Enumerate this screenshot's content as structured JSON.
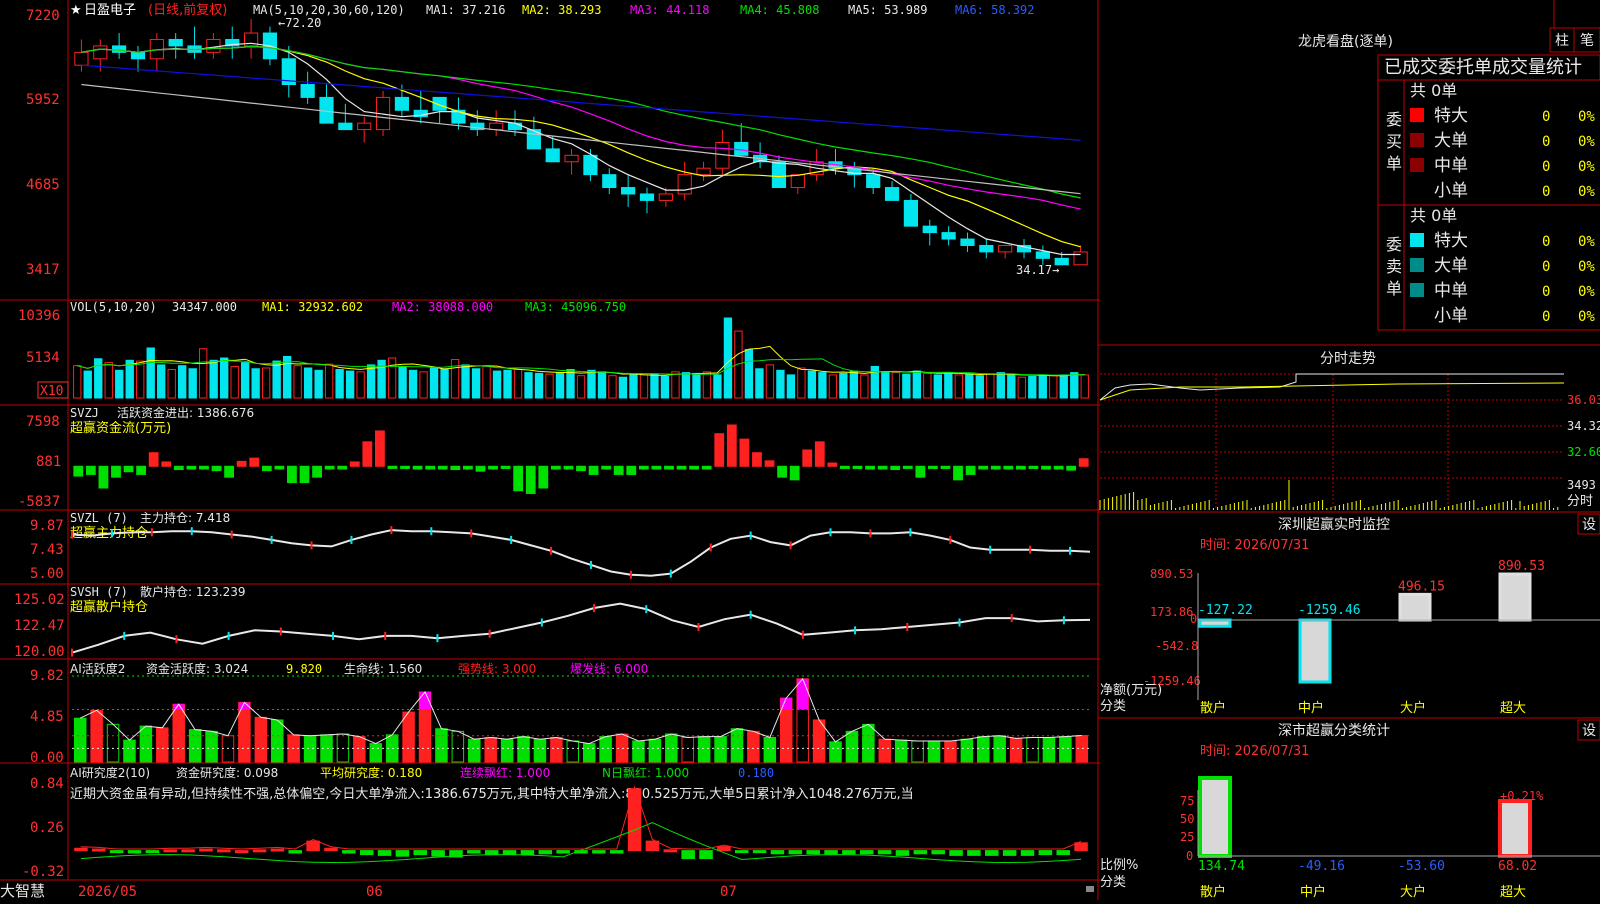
{
  "stock": {
    "star": "★",
    "name": "日盈电子",
    "mode": "(日线,前复权)"
  },
  "colors": {
    "up": "#ff2020",
    "down": "#00e5ee",
    "green": "#00e000",
    "white": "#e8e8e8",
    "yellow": "#ffff00",
    "magenta": "#ff00ff",
    "blue": "#1010dd",
    "grid": "#c00000"
  },
  "main_header": {
    "ma_label": "MA(5,10,20,30,60,120)",
    "ma1": "MA1: 37.216",
    "ma2": "MA2: 38.293",
    "ma3": "MA3: 44.118",
    "ma4": "MA4: 45.808",
    "ma5": "MA5: 53.989",
    "ma6": "MA6: 58.392",
    "high_note": "←72.20",
    "low_note": "34.17→"
  },
  "price_axis": [
    "7220",
    "5952",
    "4685",
    "3417"
  ],
  "vol_header": {
    "label": "VOL(5,10,20)",
    "value": "34347.000",
    "ma1": "MA1: 32932.602",
    "ma2": "MA2: 38088.000",
    "ma3": "MA3: 45096.750"
  },
  "vol_axis": [
    "10396",
    "5134"
  ],
  "vol_unit": "X10",
  "svzj": {
    "label": "SVZJ",
    "text": "活跃资金进出: 1386.676",
    "sub": "超赢资金流(万元)",
    "axis": [
      "7598",
      "881",
      "-5837"
    ]
  },
  "svzl": {
    "label": "SVZL (7)",
    "text": "主力持仓: 7.418",
    "sub": "超赢主力持仓",
    "axis": [
      "9.87",
      "7.43",
      "5.00"
    ]
  },
  "svsh": {
    "label": "SVSH (7)",
    "text": "散户持仓: 123.239",
    "sub": "超赢散户持仓",
    "axis": [
      "125.02",
      "122.47",
      "120.00"
    ]
  },
  "ai1": {
    "label": "AI活跃度2",
    "t1": "资金活跃度: 3.024",
    "t2": "9.820",
    "t3": "生命线: 1.560",
    "t4": "强势线: 3.000",
    "t5": "爆发线: 6.000",
    "axis": [
      "9.82",
      "4.85",
      "0.00"
    ]
  },
  "ai2": {
    "label": "AI研究度2(10)",
    "t1": "资金研究度: 0.098",
    "t2": "平均研究度: 0.180",
    "t3": "连续飘红: 1.000",
    "t4": "N日飘红: 1.000",
    "t5": "0.180",
    "comment": "近期大资金虽有异动,但持续性不强,总体偏空,今日大单净流入:1386.675万元,其中特大单净流入:890.525万元,大单5日累计净入1048.276万元,当",
    "axis": [
      "0.84",
      "0.26",
      "-0.32"
    ]
  },
  "dates": [
    "2026/05",
    "06",
    "07"
  ],
  "brand": "大智慧",
  "right": {
    "lhkp_title": "龙虎看盘(逐单)",
    "btn_zhu": "柱",
    "btn_bi": "笔",
    "wt_title": "已成交委托单成交量统计",
    "buy_label": "委买单",
    "sell_label": "委卖单",
    "buy_total": "共 0单",
    "sell_total": "共 0单",
    "buy_rows": [
      {
        "name": "特大",
        "v": "0",
        "p": "0%"
      },
      {
        "name": "大单",
        "v": "0",
        "p": "0%"
      },
      {
        "name": "中单",
        "v": "0",
        "p": "0%"
      },
      {
        "name": "小单",
        "v": "0",
        "p": "0%"
      }
    ],
    "sell_rows": [
      {
        "name": "特大",
        "v": "0",
        "p": "0%"
      },
      {
        "name": "大单",
        "v": "0",
        "p": "0%"
      },
      {
        "name": "中单",
        "v": "0",
        "p": "0%"
      },
      {
        "name": "小单",
        "v": "0",
        "p": "0%"
      }
    ],
    "fs_title": "分时走势",
    "fs_axis": [
      "36.03",
      "34.32",
      "32.60",
      "3493"
    ],
    "fs_unit": "分时",
    "sz_title": "深圳超赢实时监控",
    "sz_set": "设",
    "sz_time": "时间: 2026/07/31",
    "sz_axis": [
      "890.53",
      "173.86",
      "0",
      "-542.8",
      "-1259.46"
    ],
    "sz_ylabel": "净额(万元)",
    "sz_xlabel": "分类",
    "sz_cats": [
      "散户",
      "中户",
      "大户",
      "超大"
    ],
    "sz_labels": [
      "-127.22",
      "-1259.46",
      "496.15",
      "890.53"
    ],
    "ss_title": "深市超赢分类统计",
    "ss_set": "设",
    "ss_time": "时间: 2026/07/31",
    "ss_axis": [
      "75",
      "50",
      "25",
      "0"
    ],
    "ss_ylabel": "比例%",
    "ss_xlabel": "分类",
    "ss_cats": [
      "散户",
      "中户",
      "大户",
      "超大"
    ],
    "ss_labels": [
      "134.74",
      "-49.16",
      "-53.60",
      "68.02"
    ],
    "ss_note": "+0.21%"
  },
  "chart_data": [
    {
      "type": "candlestick",
      "title": "日盈电子 (日线,前复权)",
      "ylim": [
        34.17,
        72.2
      ],
      "candles": [
        [
          65,
          69,
          64,
          67
        ],
        [
          66,
          69,
          64,
          68
        ],
        [
          68,
          70,
          66,
          67
        ],
        [
          67,
          68,
          64,
          66
        ],
        [
          66,
          70,
          64,
          69
        ],
        [
          69,
          70,
          66,
          68
        ],
        [
          68,
          71,
          66,
          67
        ],
        [
          67,
          70,
          66,
          69
        ],
        [
          69,
          71,
          66,
          68
        ],
        [
          68,
          72.2,
          66,
          70
        ],
        [
          70,
          71,
          65,
          66
        ],
        [
          66,
          68,
          60,
          62
        ],
        [
          62,
          64,
          59,
          60
        ],
        [
          60,
          62,
          57,
          56
        ],
        [
          56,
          59,
          55,
          55
        ],
        [
          55,
          57,
          53,
          56
        ],
        [
          55,
          61,
          54,
          60
        ],
        [
          60,
          62,
          57,
          58
        ],
        [
          58,
          61,
          56,
          57
        ],
        [
          60,
          60,
          56,
          58
        ],
        [
          58,
          60,
          55,
          56
        ],
        [
          56,
          58,
          54,
          55
        ],
        [
          55,
          58,
          54,
          56
        ],
        [
          56,
          58,
          54,
          55
        ],
        [
          55,
          57,
          53,
          52
        ],
        [
          52,
          54,
          50,
          50
        ],
        [
          50,
          52,
          48,
          51
        ],
        [
          51,
          52,
          47,
          48
        ],
        [
          48,
          49,
          45,
          46
        ],
        [
          46,
          48,
          43,
          45
        ],
        [
          45,
          46,
          42,
          44
        ],
        [
          44,
          46,
          43,
          45
        ],
        [
          45,
          50,
          44,
          48
        ],
        [
          48,
          50,
          47,
          49
        ],
        [
          49,
          55,
          48,
          53
        ],
        [
          53,
          56,
          51,
          51
        ],
        [
          51,
          53,
          49,
          50
        ],
        [
          50,
          51,
          46,
          46
        ],
        [
          46,
          48,
          45,
          48
        ],
        [
          48,
          52,
          47,
          50
        ],
        [
          50,
          52,
          48,
          49
        ],
        [
          49,
          50,
          46,
          48
        ],
        [
          48,
          49,
          45,
          46
        ],
        [
          46,
          47,
          44,
          44
        ],
        [
          44,
          45,
          40,
          40
        ],
        [
          40,
          41,
          37,
          39
        ],
        [
          39,
          40,
          37,
          38
        ],
        [
          38,
          39,
          36,
          37
        ],
        [
          37,
          38,
          35,
          36
        ],
        [
          36,
          37,
          35,
          37
        ],
        [
          37,
          38,
          35,
          36
        ],
        [
          36,
          37,
          34,
          35
        ],
        [
          35,
          36,
          34.17,
          34
        ],
        [
          34,
          37,
          34,
          36
        ]
      ],
      "ma_series": [
        "MA1",
        "MA2",
        "MA3",
        "MA4",
        "MA5",
        "MA6"
      ]
    },
    {
      "type": "bar",
      "title": "VOL(5,10,20)",
      "ylim": [
        0,
        10396
      ],
      "values": [
        4200,
        3500,
        5100,
        4600,
        3600,
        4900,
        4800,
        6500,
        4300,
        3700,
        4200,
        3800,
        6400,
        4900,
        5200,
        4100,
        4600,
        3800,
        3900,
        4800,
        5400,
        4200,
        3900,
        3600,
        4400,
        3700,
        3500,
        3400,
        4300,
        4900,
        5200,
        4100,
        3600,
        3400,
        3900,
        3800,
        5000,
        4300,
        3800,
        4100,
        3500,
        3600,
        3700,
        3300,
        3200,
        3100,
        3300,
        3700,
        2900,
        3600,
        3400,
        2900,
        2700,
        3100,
        3000,
        3100,
        2800,
        3400,
        3300,
        3200,
        3400,
        3000,
        10396,
        8700,
        6300,
        3800,
        4300,
        3600,
        3000,
        3900,
        3500,
        3300,
        3000,
        3200,
        3500,
        3000,
        4100,
        3400,
        3300,
        3100,
        3500,
        3200,
        3000,
        3300,
        3000,
        3100,
        2900,
        3100,
        3300,
        3000,
        2700,
        2800,
        3000,
        2900,
        3000,
        3300,
        3000
      ]
    },
    {
      "type": "bar",
      "title": "SVZJ 超赢资金流(万元)",
      "ylim": [
        -5837,
        7598
      ],
      "values": [
        -1800,
        -1500,
        -4000,
        -2000,
        -1000,
        -1500,
        2500,
        800,
        -600,
        -500,
        -500,
        -800,
        -2000,
        900,
        1500,
        -800,
        -500,
        -3000,
        -3000,
        -2000,
        -500,
        -500,
        800,
        4500,
        6500,
        -400,
        -400,
        -500,
        -500,
        -500,
        -600,
        -500,
        -900,
        -500,
        -400,
        -4500,
        -5000,
        -4000,
        -500,
        -500,
        -800,
        -1500,
        -500,
        -1500,
        -1500,
        -500,
        -500,
        -500,
        -500,
        -500,
        -500,
        6000,
        7598,
        5000,
        2500,
        1000,
        -2000,
        -2500,
        3000,
        4500,
        600,
        -400,
        -400,
        -500,
        -500,
        -600,
        -400,
        -2000,
        -400,
        -400,
        -2500,
        -1500,
        -500,
        -500,
        -500,
        -500,
        -400,
        -500,
        -500,
        -700,
        1386
      ]
    },
    {
      "type": "line",
      "title": "SVZL 超赢主力持仓",
      "ylim": [
        5.0,
        9.87
      ],
      "values": [
        9.0,
        8.9,
        9.1,
        9.2,
        9.2,
        9.3,
        9.3,
        9.2,
        9.0,
        8.8,
        8.5,
        8.2,
        8.0,
        7.9,
        8.5,
        9.0,
        9.4,
        9.3,
        9.3,
        9.2,
        9.1,
        8.8,
        8.5,
        8.0,
        7.5,
        6.8,
        6.2,
        5.6,
        5.3,
        5.2,
        5.4,
        6.5,
        7.8,
        8.6,
        8.9,
        8.3,
        8.0,
        8.9,
        9.2,
        9.2,
        9.1,
        9.1,
        9.2,
        8.9,
        8.5,
        7.8,
        7.6,
        7.6,
        7.6,
        7.5,
        7.5,
        7.418
      ]
    },
    {
      "type": "line",
      "title": "SVSH 超赢散户持仓",
      "ylim": [
        120.0,
        125.02
      ],
      "values": [
        120.3,
        121.0,
        121.8,
        122.1,
        121.5,
        121.1,
        121.8,
        122.3,
        122.2,
        122.0,
        121.8,
        121.5,
        121.8,
        121.8,
        121.6,
        121.8,
        122.0,
        122.5,
        123.0,
        123.6,
        124.3,
        124.7,
        124.2,
        123.2,
        122.6,
        123.3,
        123.7,
        122.9,
        121.9,
        122.1,
        122.3,
        122.4,
        122.6,
        122.8,
        123.0,
        123.4,
        123.4,
        123.1,
        123.2,
        123.239
      ]
    },
    {
      "type": "bar",
      "title": "AI活跃度2",
      "ylim": [
        0,
        9.82
      ],
      "values": [
        5.0,
        5.9,
        4.3,
        2.5,
        4.1,
        3.9,
        6.6,
        3.7,
        3.5,
        3.0,
        6.8,
        5.1,
        4.8,
        3.1,
        3.0,
        3.1,
        3.2,
        2.9,
        2.1,
        3.1,
        5.7,
        8.0,
        3.8,
        3.5,
        2.6,
        2.8,
        2.6,
        2.9,
        2.6,
        2.8,
        2.4,
        2.1,
        2.9,
        3.2,
        2.4,
        2.6,
        3.2,
        2.8,
        2.9,
        2.9,
        3.8,
        3.5,
        2.8,
        7.3,
        9.5,
        4.8,
        2.3,
        3.5,
        4.3,
        2.6,
        2.5,
        2.4,
        2.4,
        2.4,
        2.6,
        2.9,
        3.0,
        2.7,
        2.8,
        2.8,
        2.9,
        3.024
      ]
    },
    {
      "type": "bar",
      "title": "AI研究度2(10)",
      "ylim": [
        -0.32,
        0.84
      ],
      "values": [
        0.03,
        0.02,
        -0.02,
        -0.03,
        -0.02,
        0.01,
        0.01,
        0.02,
        0.01,
        0.0,
        0.01,
        0.02,
        -0.03,
        0.12,
        0.03,
        -0.03,
        -0.05,
        -0.06,
        -0.07,
        -0.05,
        -0.07,
        -0.08,
        -0.03,
        -0.05,
        -0.05,
        -0.05,
        -0.04,
        -0.03,
        -0.03,
        -0.03,
        -0.03,
        0.78,
        0.12,
        0.01,
        -0.1,
        -0.1,
        0.05,
        -0.02,
        -0.02,
        -0.04,
        -0.04,
        -0.04,
        -0.04,
        -0.04,
        -0.04,
        -0.04,
        -0.06,
        -0.04,
        -0.04,
        -0.06,
        -0.06,
        -0.06,
        -0.06,
        -0.06,
        -0.05,
        -0.05,
        0.098
      ]
    },
    {
      "type": "bar",
      "title": "深圳超赢实时监控",
      "categories": [
        "散户",
        "中户",
        "大户",
        "超大"
      ],
      "values": [
        -127.22,
        -1259.46,
        496.15,
        890.53
      ],
      "ylabel": "净额(万元)",
      "xlabel": "分类",
      "ylim": [
        -1259.46,
        890.53
      ]
    },
    {
      "type": "bar",
      "title": "深市超赢分类统计",
      "categories": [
        "散户",
        "中户",
        "大户",
        "超大"
      ],
      "values": [
        134.74,
        -49.16,
        -53.6,
        68.02
      ],
      "ylabel": "比例%",
      "xlabel": "分类",
      "ylim": [
        0,
        75
      ]
    }
  ]
}
